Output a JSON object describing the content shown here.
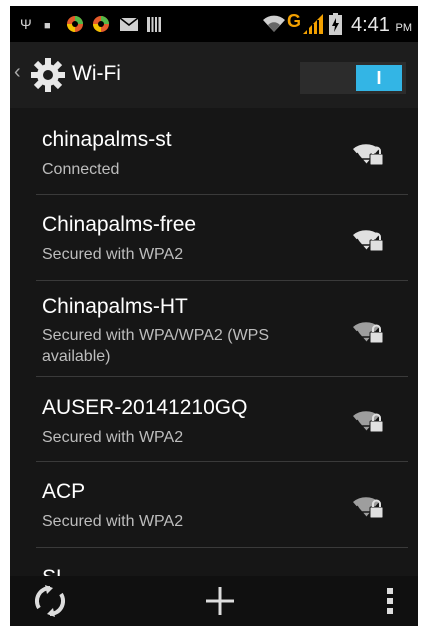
{
  "status_bar": {
    "time": "4:41",
    "ampm": "PM",
    "network_type": "G",
    "notification_icons": [
      "usb-icon",
      "lock-icon",
      "app-icon",
      "app-icon",
      "mail-icon",
      "storage-icon"
    ],
    "system_icons": [
      "wifi-icon",
      "signal-icon",
      "battery-icon"
    ]
  },
  "action_bar": {
    "title": "Wi-Fi",
    "toggle_label": "I",
    "toggle_state": "on",
    "accent_color": "#33b5e5"
  },
  "networks": [
    {
      "name": "chinapalms-st",
      "status": "Connected",
      "icon": "wifi-locked-icon"
    },
    {
      "name": "Chinapalms-free",
      "status": "Secured with WPA2",
      "icon": "wifi-locked-icon"
    },
    {
      "name": "Chinapalms-HT",
      "status": "Secured with WPA/WPA2 (WPS available)",
      "icon": "wifi-locked-icon"
    },
    {
      "name": "AUSER-20141210GQ",
      "status": "Secured with WPA2",
      "icon": "wifi-locked-icon"
    },
    {
      "name": "ACP",
      "status": "Secured with WPA2",
      "icon": "wifi-locked-icon"
    },
    {
      "name": "SL",
      "status": "",
      "icon": "wifi-locked-icon"
    }
  ],
  "bottom_bar": {
    "actions": [
      "refresh-icon",
      "add-network-icon",
      "overflow-menu-icon"
    ]
  }
}
